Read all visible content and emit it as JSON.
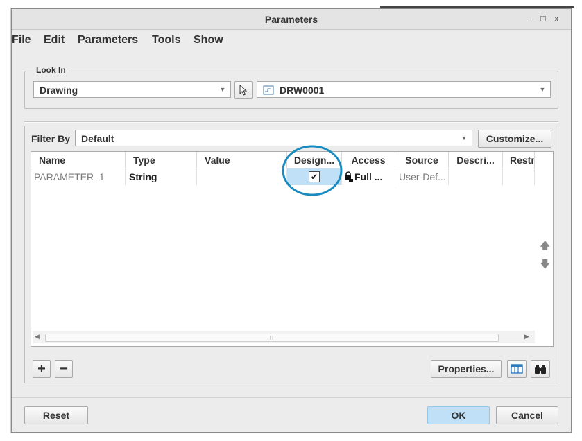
{
  "window": {
    "title": "Parameters",
    "minimize": "–",
    "maximize": "□",
    "close": "x"
  },
  "menu": [
    "File",
    "Edit",
    "Parameters",
    "Tools",
    "Show"
  ],
  "look_in": {
    "legend": "Look In",
    "selection": "Drawing",
    "model": "DRW0001"
  },
  "filter": {
    "label": "Filter By",
    "value": "Default",
    "customize": "Customize..."
  },
  "table": {
    "columns": [
      "Name",
      "Type",
      "Value",
      "Design...",
      "Access",
      "Source",
      "Descri...",
      "Restr"
    ],
    "rows": [
      {
        "name": "PARAMETER_1",
        "type": "String",
        "value": "",
        "designate": "✔",
        "access": "Full ...",
        "source": "User-Def...",
        "description": "",
        "restricted": ""
      }
    ],
    "scroll_grip": "IIII"
  },
  "buttons": {
    "add": "+",
    "remove": "−",
    "properties": "Properties...",
    "reset": "Reset",
    "ok": "OK",
    "cancel": "Cancel"
  },
  "icons": {
    "move_up": "arrow-up-icon",
    "move_down": "arrow-down-icon",
    "columns": "table-columns-icon",
    "find": "binoculars-icon",
    "pointer": "cursor-arrow-icon",
    "lock": "lock-icon"
  },
  "colors": {
    "accent": "#1a8bbf",
    "highlight": "#bfe0f7",
    "window_bg": "#ececec"
  }
}
